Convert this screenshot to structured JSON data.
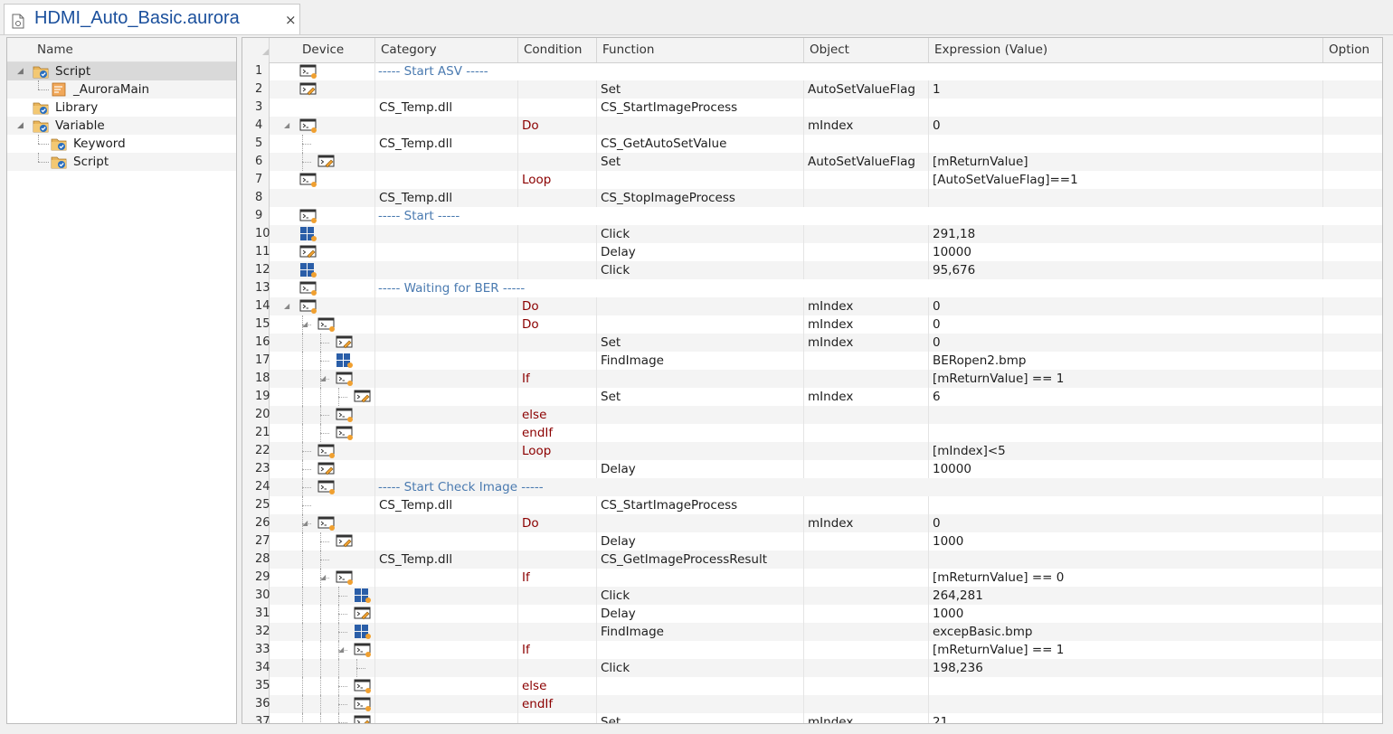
{
  "tab": {
    "title": "HDMI_Auto_Basic.aurora",
    "close_glyph": "×",
    "icon": "document-icon"
  },
  "tree": {
    "header": "Name",
    "items": [
      {
        "label": "Script",
        "level": 0,
        "expanded": true,
        "icon": "folder-script-icon",
        "selected": true
      },
      {
        "label": "_AuroraMain",
        "level": 1,
        "icon": "script-file-icon"
      },
      {
        "label": "Library",
        "level": 0,
        "icon": "folder-library-icon"
      },
      {
        "label": "Variable",
        "level": 0,
        "expanded": true,
        "icon": "folder-variable-icon"
      },
      {
        "label": "Keyword",
        "level": 1,
        "icon": "folder-keyword-icon"
      },
      {
        "label": "Script",
        "level": 1,
        "icon": "folder-script-icon"
      }
    ]
  },
  "grid": {
    "columns": [
      "Device",
      "Category",
      "Condition",
      "Function",
      "Object",
      "Expression (Value)",
      "Option"
    ],
    "rows": [
      {
        "n": "1",
        "depth": 0,
        "icon": "console",
        "comment": "----- Start ASV -----"
      },
      {
        "n": "2",
        "depth": 0,
        "icon": "console-set",
        "function": "Set",
        "object": "AutoSetValueFlag",
        "expression": "1"
      },
      {
        "n": "3",
        "depth": 0,
        "icon": "",
        "category": "CS_Temp.dll",
        "function": "CS_StartImageProcess"
      },
      {
        "n": "4",
        "depth": 0,
        "icon": "console",
        "collapse": true,
        "condition": "Do",
        "object": "mIndex",
        "expression": "0"
      },
      {
        "n": "5",
        "depth": 1,
        "icon": "",
        "category": "CS_Temp.dll",
        "function": "CS_GetAutoSetValue"
      },
      {
        "n": "6",
        "depth": 1,
        "icon": "console-set",
        "function": "Set",
        "object": "AutoSetValueFlag",
        "expression": "[mReturnValue]"
      },
      {
        "n": "7",
        "depth": 0,
        "icon": "console",
        "condition": "Loop",
        "expression": "[AutoSetValueFlag]==1"
      },
      {
        "n": "8",
        "depth": 0,
        "icon": "",
        "category": "CS_Temp.dll",
        "function": "CS_StopImageProcess"
      },
      {
        "n": "9",
        "depth": 0,
        "icon": "console",
        "comment": "----- Start -----"
      },
      {
        "n": "10",
        "depth": 0,
        "icon": "grid",
        "function": "Click",
        "expression": "291,18"
      },
      {
        "n": "11",
        "depth": 0,
        "icon": "console-set",
        "function": "Delay",
        "expression": "10000"
      },
      {
        "n": "12",
        "depth": 0,
        "icon": "grid",
        "function": "Click",
        "expression": "95,676"
      },
      {
        "n": "13",
        "depth": 0,
        "icon": "console",
        "comment": "----- Waiting for BER -----"
      },
      {
        "n": "14",
        "depth": 0,
        "icon": "console",
        "collapse": true,
        "condition": "Do",
        "object": "mIndex",
        "expression": "0"
      },
      {
        "n": "15",
        "depth": 1,
        "icon": "console",
        "collapse": true,
        "condition": "Do",
        "object": "mIndex",
        "expression": "0"
      },
      {
        "n": "16",
        "depth": 2,
        "icon": "console-set",
        "function": "Set",
        "object": "mIndex",
        "expression": "0"
      },
      {
        "n": "17",
        "depth": 2,
        "icon": "grid",
        "function": "FindImage",
        "expression": "BERopen2.bmp"
      },
      {
        "n": "18",
        "depth": 2,
        "icon": "console",
        "collapse": true,
        "condition": "If",
        "expression": "[mReturnValue] == 1"
      },
      {
        "n": "19",
        "depth": 3,
        "icon": "console-set",
        "function": "Set",
        "object": "mIndex",
        "expression": "6"
      },
      {
        "n": "20",
        "depth": 2,
        "icon": "console",
        "condition": "else"
      },
      {
        "n": "21",
        "depth": 2,
        "icon": "console",
        "condition": "endIf"
      },
      {
        "n": "22",
        "depth": 1,
        "icon": "console",
        "condition": "Loop",
        "expression": "[mIndex]<5"
      },
      {
        "n": "23",
        "depth": 1,
        "icon": "console-set",
        "function": "Delay",
        "expression": "10000"
      },
      {
        "n": "24",
        "depth": 1,
        "icon": "console",
        "comment": "----- Start Check Image -----"
      },
      {
        "n": "25",
        "depth": 1,
        "icon": "",
        "category": "CS_Temp.dll",
        "function": "CS_StartImageProcess"
      },
      {
        "n": "26",
        "depth": 1,
        "icon": "console",
        "collapse": true,
        "condition": "Do",
        "object": "mIndex",
        "expression": "0"
      },
      {
        "n": "27",
        "depth": 2,
        "icon": "console-set",
        "function": "Delay",
        "expression": "1000"
      },
      {
        "n": "28",
        "depth": 2,
        "icon": "",
        "category": "CS_Temp.dll",
        "function": "CS_GetImageProcessResult"
      },
      {
        "n": "29",
        "depth": 2,
        "icon": "console",
        "collapse": true,
        "condition": "If",
        "expression": "[mReturnValue] == 0"
      },
      {
        "n": "30",
        "depth": 3,
        "icon": "grid",
        "function": "Click",
        "expression": "264,281"
      },
      {
        "n": "31",
        "depth": 3,
        "icon": "console-set",
        "function": "Delay",
        "expression": "1000"
      },
      {
        "n": "32",
        "depth": 3,
        "icon": "grid",
        "function": "FindImage",
        "expression": "excepBasic.bmp"
      },
      {
        "n": "33",
        "depth": 3,
        "icon": "console",
        "collapse": true,
        "condition": "If",
        "expression": "[mReturnValue] == 1"
      },
      {
        "n": "34",
        "depth": 4,
        "icon": "",
        "function": "Click",
        "expression": "198,236"
      },
      {
        "n": "35",
        "depth": 3,
        "icon": "console",
        "condition": "else"
      },
      {
        "n": "36",
        "depth": 3,
        "icon": "console",
        "condition": "endIf"
      },
      {
        "n": "37",
        "depth": 3,
        "icon": "console-set",
        "function": "Set",
        "object": "mIndex",
        "expression": "21"
      }
    ]
  },
  "colors": {
    "condition": "#8b0000",
    "comment": "#4a7ab0",
    "title": "#1a4f9c",
    "icon_blue": "#2a5ea8",
    "icon_orange": "#f0a030"
  }
}
